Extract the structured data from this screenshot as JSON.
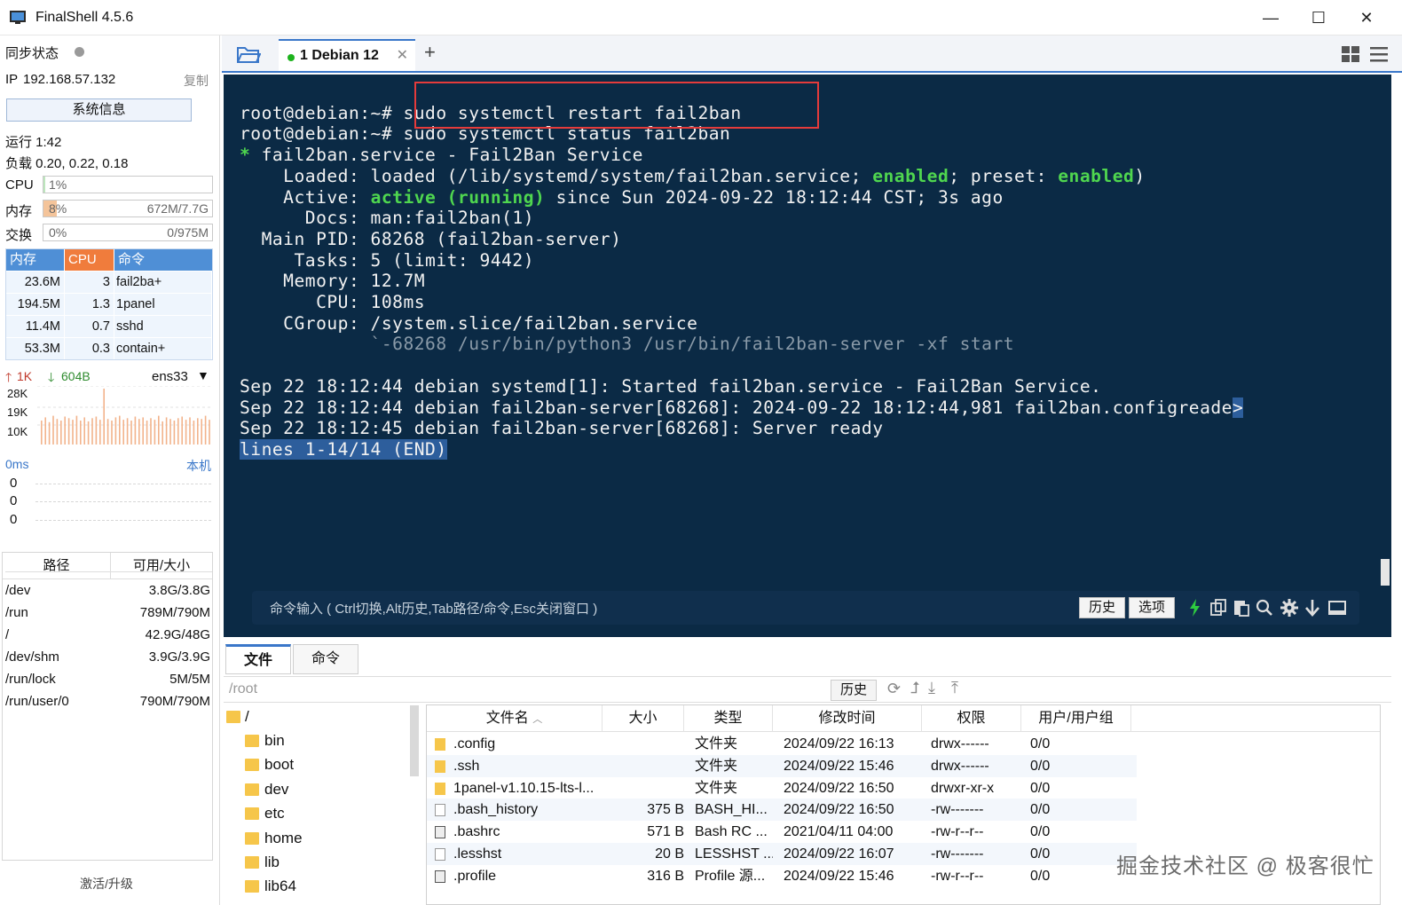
{
  "window": {
    "title": "FinalShell 4.5.6"
  },
  "left": {
    "sync_label": "同步状态",
    "ip_label": "IP",
    "ip_value": "192.168.57.132",
    "copy_label": "复制",
    "sysinfo_button": "系统信息",
    "uptime": "运行 1:42",
    "load": "负载 0.20, 0.22, 0.18",
    "cpu": {
      "label": "CPU",
      "value": "1%",
      "fraction": 0.01
    },
    "mem": {
      "label": "内存",
      "value": "8%",
      "detail": "672M/7.7G",
      "fraction": 0.08
    },
    "swap": {
      "label": "交换",
      "value": "0%",
      "detail": "0/975M",
      "fraction": 0
    },
    "proc_headers": [
      "内存",
      "CPU",
      "命令"
    ],
    "procs": [
      {
        "mem": "23.6M",
        "cpu": "3",
        "cmd": "fail2ba+"
      },
      {
        "mem": "194.5M",
        "cpu": "1.3",
        "cmd": "1panel"
      },
      {
        "mem": "11.4M",
        "cpu": "0.7",
        "cmd": "sshd"
      },
      {
        "mem": "53.3M",
        "cpu": "0.3",
        "cmd": "contain+"
      }
    ],
    "net": {
      "up": "1K",
      "down": "604B",
      "iface": "ens33",
      "ticks": [
        "28K",
        "19K",
        "10K"
      ]
    },
    "ping": {
      "label": "0ms",
      "host": "本机",
      "ticks": [
        "0",
        "0",
        "0"
      ]
    },
    "disk_headers": [
      "路径",
      "可用/大小"
    ],
    "disks": [
      {
        "path": "/dev",
        "size": "3.8G/3.8G"
      },
      {
        "path": "/run",
        "size": "789M/790M"
      },
      {
        "path": "/",
        "size": "42.9G/48G"
      },
      {
        "path": "/dev/shm",
        "size": "3.9G/3.9G"
      },
      {
        "path": "/run/lock",
        "size": "5M/5M"
      },
      {
        "path": "/run/user/0",
        "size": "790M/790M"
      }
    ],
    "activate": "激活/升级"
  },
  "tabs": [
    {
      "label": "1 Debian 12",
      "active": true
    }
  ],
  "terminal": {
    "lines": [
      "root@debian:~# sudo systemctl restart fail2ban",
      "root@debian:~# sudo systemctl status fail2ban",
      "* fail2ban.service - Fail2Ban Service",
      "    Loaded: loaded (/lib/systemd/system/fail2ban.service; enabled; preset: enabled)",
      "    Active: active (running) since Sun 2024-09-22 18:12:44 CST; 3s ago",
      "      Docs: man:fail2ban(1)",
      "  Main PID: 68268 (fail2ban-server)",
      "     Tasks: 5 (limit: 9442)",
      "    Memory: 12.7M",
      "       CPU: 108ms",
      "    CGroup: /system.slice/fail2ban.service",
      "            `-68268 /usr/bin/python3 /usr/bin/fail2ban-server -xf start",
      "",
      "Sep 22 18:12:44 debian systemd[1]: Started fail2ban.service - Fail2Ban Service.",
      "Sep 22 18:12:44 debian fail2ban-server[68268]: 2024-09-22 18:12:44,981 fail2ban.configreade>",
      "Sep 22 18:12:45 debian fail2ban-server[68268]: Server ready",
      "lines 1-14/14 (END)"
    ],
    "cmd_hint": "命令输入 ( Ctrl切换,Alt历史,Tab路径/命令,Esc关闭窗口 )",
    "history_btn": "历史",
    "options_btn": "选项"
  },
  "files": {
    "tabs": [
      "文件",
      "命令"
    ],
    "path": "/root",
    "history_btn": "历史",
    "tree": [
      "/",
      "bin",
      "boot",
      "dev",
      "etc",
      "home",
      "lib",
      "lib64"
    ],
    "headers": [
      "文件名",
      "大小",
      "类型",
      "修改时间",
      "权限",
      "用户/用户组"
    ],
    "rows": [
      {
        "name": ".config",
        "size": "",
        "type": "文件夹",
        "mtime": "2024/09/22 16:13",
        "perm": "drwx------",
        "owner": "0/0",
        "icon": "folder"
      },
      {
        "name": ".ssh",
        "size": "",
        "type": "文件夹",
        "mtime": "2024/09/22 15:46",
        "perm": "drwx------",
        "owner": "0/0",
        "icon": "folder"
      },
      {
        "name": "1panel-v1.10.15-lts-l...",
        "size": "",
        "type": "文件夹",
        "mtime": "2024/09/22 16:50",
        "perm": "drwxr-xr-x",
        "owner": "0/0",
        "icon": "folder"
      },
      {
        "name": ".bash_history",
        "size": "375 B",
        "type": "BASH_HI...",
        "mtime": "2024/09/22 16:50",
        "perm": "-rw-------",
        "owner": "0/0",
        "icon": "file"
      },
      {
        "name": ".bashrc",
        "size": "571 B",
        "type": "Bash RC ...",
        "mtime": "2021/04/11 04:00",
        "perm": "-rw-r--r--",
        "owner": "0/0",
        "icon": "doc"
      },
      {
        "name": ".lesshst",
        "size": "20 B",
        "type": "LESSHST ...",
        "mtime": "2024/09/22 16:07",
        "perm": "-rw-------",
        "owner": "0/0",
        "icon": "file"
      },
      {
        "name": ".profile",
        "size": "316 B",
        "type": "Profile 源...",
        "mtime": "2024/09/22 15:46",
        "perm": "-rw-r--r--",
        "owner": "0/0",
        "icon": "doc"
      }
    ]
  },
  "watermark": "掘金技术社区 @ 极客很忙"
}
